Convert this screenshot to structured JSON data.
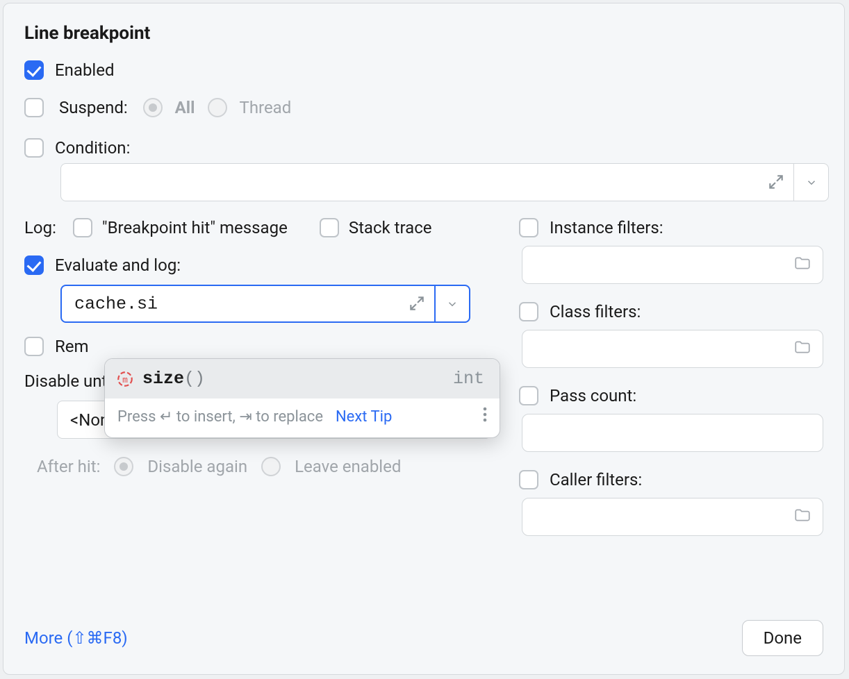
{
  "title": "Line breakpoint",
  "enabled": {
    "label": "Enabled",
    "checked": true
  },
  "suspend": {
    "label": "Suspend:",
    "checked": false,
    "opt_all": "All",
    "opt_thread": "Thread"
  },
  "condition": {
    "label": "Condition:",
    "checked": false,
    "value": ""
  },
  "log": {
    "label": "Log:",
    "hit_message": {
      "label": "\"Breakpoint hit\" message",
      "checked": false
    },
    "stack_trace": {
      "label": "Stack trace",
      "checked": false
    }
  },
  "evaluate": {
    "label": "Evaluate and log:",
    "checked": true,
    "value": "cache.si"
  },
  "completion": {
    "prefix": "si",
    "rest": "ze",
    "suffix": "()",
    "return_type": "int",
    "hint": "Press ↵ to insert, ⇥ to replace",
    "next_tip": "Next Tip"
  },
  "remove_once_hit": {
    "label": "Remove once hit",
    "checked": false,
    "visible_prefix": "Rem"
  },
  "disable_until": {
    "label": "Disable until hitting the following breakpoint:",
    "selected": "<None>"
  },
  "after_hit": {
    "label": "After hit:",
    "opt_disable": "Disable again",
    "opt_leave": "Leave enabled"
  },
  "filters": {
    "instance": "Instance filters:",
    "class": "Class filters:",
    "pass_count": "Pass count:",
    "caller": "Caller filters:"
  },
  "footer": {
    "more": "More (⇧⌘F8)",
    "done": "Done"
  }
}
